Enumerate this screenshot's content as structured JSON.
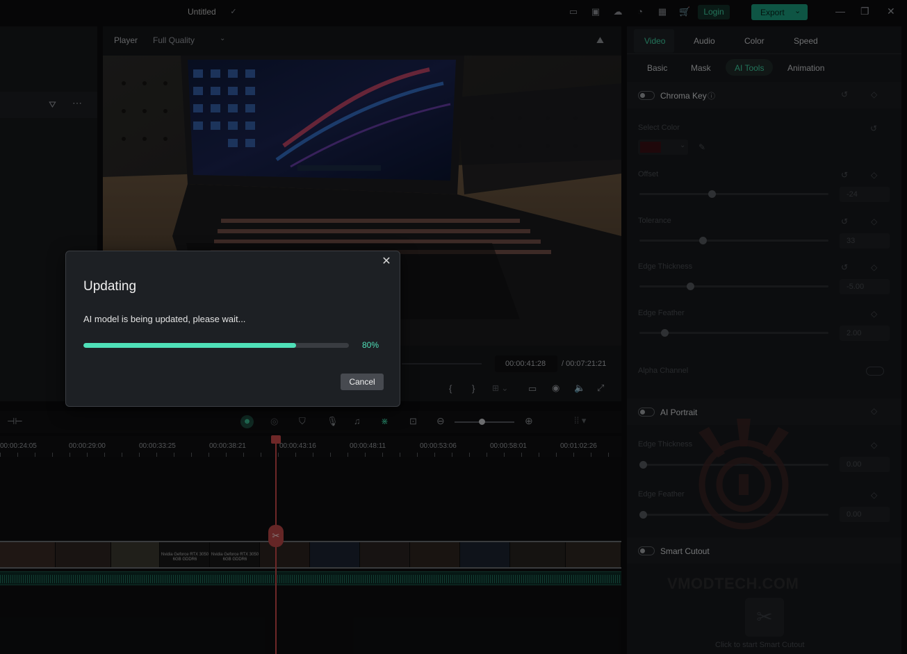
{
  "window": {
    "title": "Untitled",
    "login_label": "Login",
    "export_label": "Export"
  },
  "player": {
    "label": "Player",
    "quality": "Full Quality",
    "current_time": "00:00:41:28",
    "total_time": "/ 00:07:21:21"
  },
  "right_panel": {
    "tabs": [
      "Video",
      "Audio",
      "Color",
      "Speed"
    ],
    "active_tab": "Video",
    "subtabs": [
      "Basic",
      "Mask",
      "AI Tools",
      "Animation"
    ],
    "active_subtab": "AI Tools",
    "chroma_key": {
      "label": "Chroma Key",
      "select_color": "Select Color",
      "offset_label": "Offset",
      "offset_value": "-24",
      "offset_level": 0.38,
      "tolerance_label": "Tolerance",
      "tolerance_value": "33",
      "tolerance_level": 0.33,
      "edge_thickness_label": "Edge Thickness",
      "edge_thickness_value": "-5.00",
      "edge_thickness_level": 0.26,
      "edge_feather_label": "Edge Feather",
      "edge_feather_value": "2.00",
      "edge_feather_level": 0.12,
      "alpha_channel_label": "Alpha Channel",
      "swatch_color": "#3a0f14"
    },
    "ai_portrait": {
      "label": "AI Portrait",
      "edge_thickness_label": "Edge Thickness",
      "edge_thickness_value": "0.00",
      "edge_thickness_level": 0.0,
      "edge_feather_label": "Edge Feather",
      "edge_feather_value": "0.00",
      "edge_feather_level": 0.0
    },
    "smart_cutout": {
      "label": "Smart Cutout",
      "hint": "Click to start Smart Cutout"
    }
  },
  "timeline": {
    "ruler_labels": [
      "00:00:24:05",
      "00:00:29:00",
      "00:00:33:25",
      "00:00:38:21",
      "00:00:43:16",
      "00:00:48:11",
      "00:00:53:06",
      "00:00:58:01",
      "00:01:02:26"
    ],
    "clip_captions": [
      "Nvidia Geforce RTX 3050",
      "Nvidia Geforce RTX 3050"
    ],
    "clip_caption_sub": "6GB GDDR6"
  },
  "dialog": {
    "title": "Updating",
    "message": "AI model is being updated, please wait...",
    "progress": 0.8,
    "progress_label": "80%",
    "cancel_label": "Cancel"
  },
  "watermark": "VMODTECH.COM",
  "colors": {
    "accent": "#4fe0b8",
    "export": "#1a9c7d",
    "playhead": "#c94a4a"
  }
}
